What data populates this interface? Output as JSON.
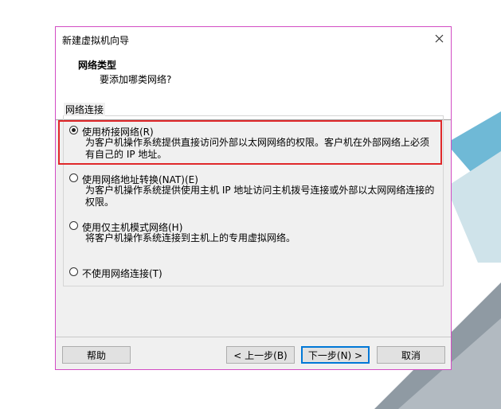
{
  "window": {
    "title": "新建虚拟机向导"
  },
  "header": {
    "title": "网络类型",
    "subtitle": "要添加哪类网络?"
  },
  "group": {
    "label": "网络连接"
  },
  "options": [
    {
      "label": "使用桥接网络(R)",
      "desc": "为客户机操作系统提供直接访问外部以太网网络的权限。客户机在外部网络上必须有自己的 IP 地址。",
      "checked": true
    },
    {
      "label": "使用网络地址转换(NAT)(E)",
      "desc": "为客户机操作系统提供使用主机 IP 地址访问主机拨号连接或外部以太网网络连接的权限。",
      "checked": false
    },
    {
      "label": "使用仅主机模式网络(H)",
      "desc": "将客户机操作系统连接到主机上的专用虚拟网络。",
      "checked": false
    },
    {
      "label": "不使用网络连接(T)",
      "desc": "",
      "checked": false
    }
  ],
  "buttons": {
    "help": "帮助",
    "back": "< 上一步(B)",
    "next": "下一步(N) >",
    "cancel": "取消"
  },
  "icons": {
    "close": "close-icon"
  },
  "colors": {
    "highlight": "#e0282a",
    "border": "#d24cc4",
    "accent": "#0078d7"
  }
}
